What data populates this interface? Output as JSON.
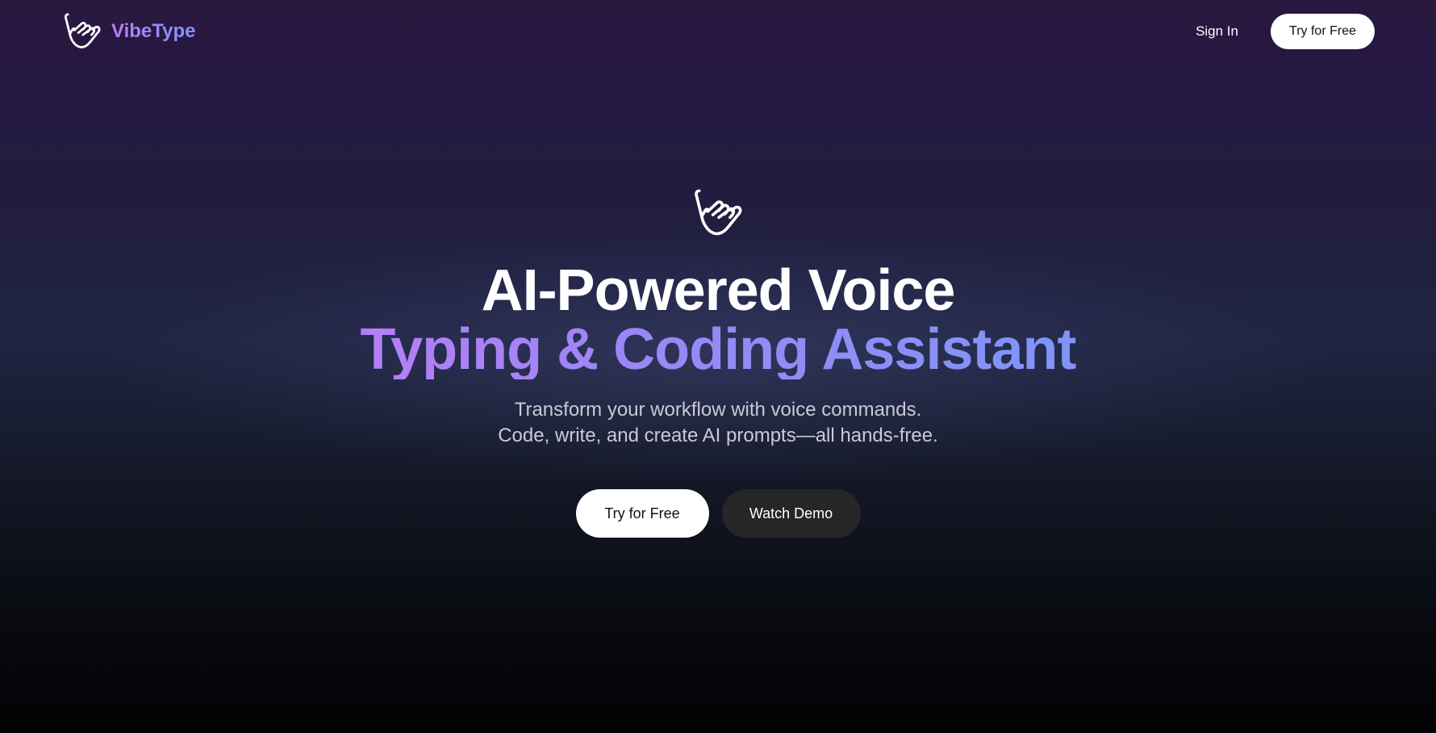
{
  "nav": {
    "brand_name": "VibeType",
    "brand_icon": "hand-shaka-icon",
    "sign_in_label": "Sign In",
    "cta_label": "Try for Free"
  },
  "hero": {
    "icon": "hand-shaka-icon",
    "headline_line1": "AI-Powered Voice",
    "headline_line2": "Typing & Coding Assistant",
    "subtitle_line1": "Transform your workflow with voice commands.",
    "subtitle_line2": "Code, write, and create AI prompts—all hands-free.",
    "primary_cta_label": "Try for Free",
    "secondary_cta_label": "Watch Demo"
  },
  "colors": {
    "accent_purple": "#b57ef6",
    "accent_blue": "#7f95f7",
    "background_top": "#2a1740",
    "background_bottom": "#030305"
  }
}
